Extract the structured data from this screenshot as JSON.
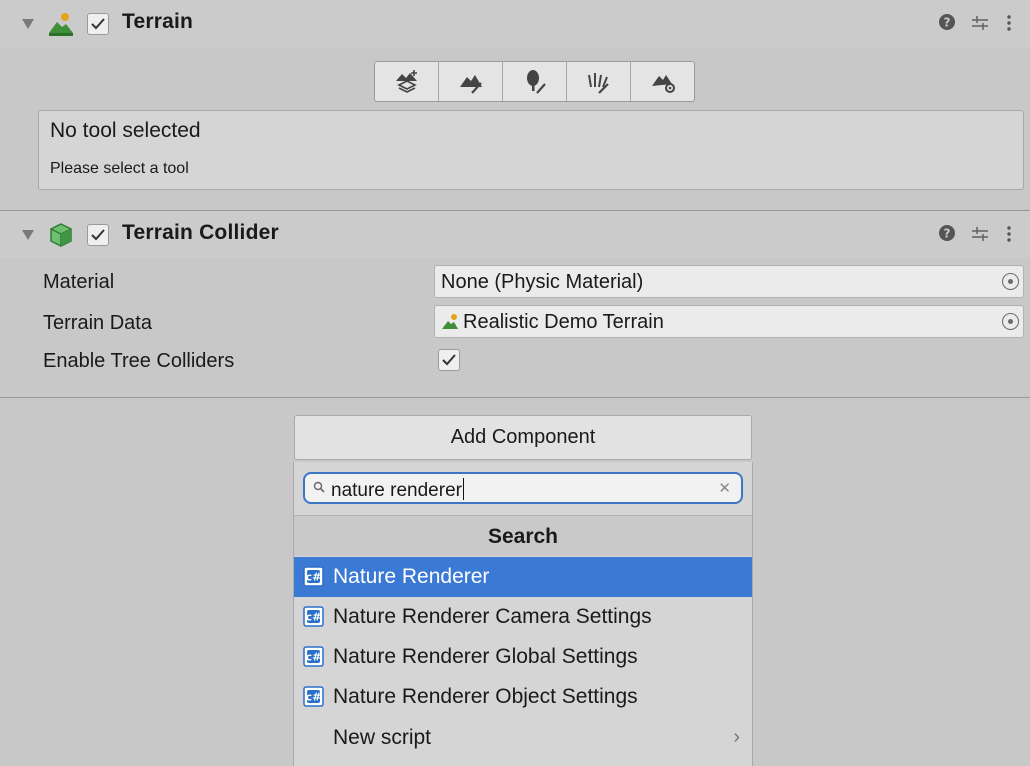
{
  "terrain": {
    "title": "Terrain",
    "enabled": true,
    "tools": [
      "create-neighbor-terrains-icon",
      "paint-terrain-icon",
      "paint-trees-icon",
      "paint-details-icon",
      "terrain-settings-icon"
    ],
    "help_title": "No tool selected",
    "help_text": "Please select a tool"
  },
  "collider": {
    "title": "Terrain Collider",
    "enabled": true,
    "material_label": "Material",
    "material_value": "None (Physic Material)",
    "terrain_data_label": "Terrain Data",
    "terrain_data_value": "Realistic Demo Terrain",
    "tree_colliders_label": "Enable Tree Colliders",
    "tree_colliders_checked": true
  },
  "add_component": {
    "button_label": "Add Component",
    "search_value": "nature renderer",
    "section_title": "Search",
    "results": [
      {
        "label": "Nature Renderer",
        "selected": true
      },
      {
        "label": "Nature Renderer Camera Settings",
        "selected": false
      },
      {
        "label": "Nature Renderer Global Settings",
        "selected": false
      },
      {
        "label": "Nature Renderer Object Settings",
        "selected": false
      }
    ],
    "new_script_label": "New script"
  },
  "colors": {
    "selection": "#3a79d4",
    "search_focus": "#3b75c4",
    "panel_bg": "#c8c8c8"
  }
}
